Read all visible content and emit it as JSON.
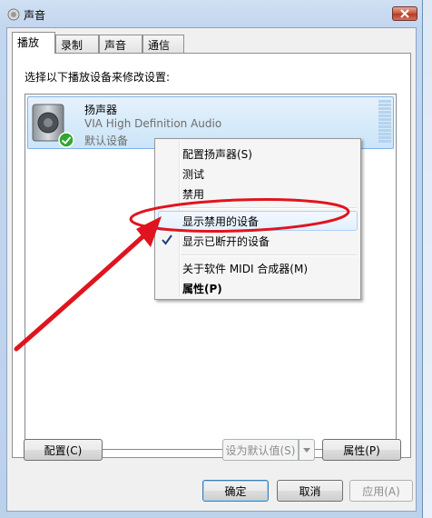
{
  "window": {
    "title": "声音"
  },
  "tabs": [
    {
      "label": "播放"
    },
    {
      "label": "录制"
    },
    {
      "label": "声音"
    },
    {
      "label": "通信"
    }
  ],
  "instruction": "选择以下播放设备来修改设置:",
  "device": {
    "name": "扬声器",
    "driver": "VIA High Definition Audio",
    "status": "默认设备"
  },
  "context_menu": {
    "items": [
      {
        "label": "配置扬声器(S)"
      },
      {
        "label": "测试"
      },
      {
        "label": "禁用"
      },
      {
        "label": "显示禁用的设备"
      },
      {
        "label": "显示已断开的设备",
        "checked": true
      },
      {
        "label": "关于软件 MIDI 合成器(M)"
      },
      {
        "label": "属性(P)",
        "bold": true
      }
    ]
  },
  "buttons": {
    "configure": "配置(C)",
    "set_default": "设为默认值(S)",
    "properties": "属性(P)",
    "ok": "确定",
    "cancel": "取消",
    "apply": "应用(A)"
  },
  "colors": {
    "annotation": "#e0141e",
    "selection": "#cbe5f8"
  },
  "icons": {
    "speaker": "speaker-icon",
    "default_badge": "check-badge-icon",
    "close": "close-icon"
  }
}
